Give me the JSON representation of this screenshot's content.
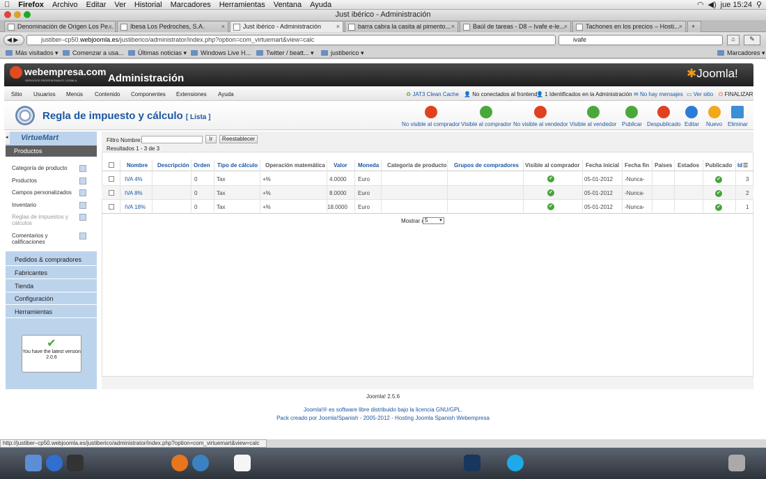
{
  "mac_menu": {
    "app": "Firefox",
    "items": [
      "Archivo",
      "Editar",
      "Ver",
      "Historial",
      "Marcadores",
      "Herramientas",
      "Ventana",
      "Ayuda"
    ],
    "clock": "jue 15:24"
  },
  "window_title": "Just ibérico - Administración",
  "tabs": [
    {
      "label": "Denominación de Origen Los Pe..."
    },
    {
      "label": "Ibesa Los Pedroches, S.A."
    },
    {
      "label": "Just ibérico - Administración"
    },
    {
      "label": "barra cabra la casita al pimento..."
    },
    {
      "label": "Baúl de tareas - D8 – Ivafe e-le..."
    },
    {
      "label": "Tachones en los precios – Hosti..."
    }
  ],
  "url": {
    "prefix": "justiber–cp50.",
    "domain": "webjoomla.es",
    "path": "/justiberico/administrator/index.php?option=com_virtuemart&view=calc"
  },
  "search_value": "ivafe",
  "bookmarks": [
    "Más visitados ▾",
    "Comenzar a usa...",
    "Últimas noticias ▾",
    "Windows Live H...",
    "Twitter / beatt... ▾",
    "justiberico ▾",
    "Marcadores ▾"
  ],
  "header": {
    "logo": "webempresa.com",
    "logo_sub": "SERVICIOS PROFESIONALES JOOMLA",
    "title": "Administración",
    "brand": "Joomla!"
  },
  "topmenu": [
    "Sitio",
    "Usuarios",
    "Menús",
    "Contenido",
    "Componentes",
    "Extensiones",
    "Ayuda"
  ],
  "status": {
    "cache": "JAT3 Clean Cache",
    "frontend": "No conectados al frontend",
    "admin": "1 Identificados en la Administración",
    "messages": "No hay mensajes",
    "view": "Ver sitio",
    "logout": "FINALIZAR"
  },
  "page": {
    "title": "Regla de impuesto y cálculo",
    "subtitle": "[ Lista ]"
  },
  "toolbar": [
    {
      "label": "No visible al comprador",
      "color": "#e0421f"
    },
    {
      "label": "Visible al comprador",
      "color": "#4aa83b"
    },
    {
      "label": "No visible al vendedor",
      "color": "#e0421f"
    },
    {
      "label": "Visible al vendedor",
      "color": "#4aa83b"
    },
    {
      "label": "Publicar",
      "color": "#4aa83b"
    },
    {
      "label": "Despublicado",
      "color": "#e0421f"
    },
    {
      "label": "Editar",
      "color": "#2b7cd6"
    },
    {
      "label": "Nuevo",
      "color": "#f2a81c"
    },
    {
      "label": "Eliminar",
      "color": "#3c8fd6"
    }
  ],
  "sidebar": {
    "logo": "VirtueMart",
    "head": "Productos",
    "items": [
      "Categoría de producto",
      "Productos",
      "Campos personalizados",
      "Inventario",
      "Reglas de impuestos y cálculos",
      "Comentarios y calificaciones"
    ],
    "groups": [
      "Pedidos & compradores",
      "Fabricantes",
      "Tienda",
      "Configuración",
      "Herramientas"
    ],
    "version_text": "You have the latest version",
    "version": "2.0.6"
  },
  "filter": {
    "label": "Filtro Nombre:",
    "go": "Ir",
    "reset": "Reestablecer",
    "results": "Resultados 1 - 3 de 3"
  },
  "table": {
    "headers": [
      "Nombre",
      "Descripción",
      "Orden",
      "Tipo de cálculo",
      "Operación matemática",
      "Valor",
      "Moneda",
      "Categoría de producto",
      "Grupos de compradores",
      "Visible al comprador",
      "Fecha inicial",
      "Fecha fin",
      "Países",
      "Estados",
      "Publicado",
      "Id"
    ],
    "rows": [
      {
        "name": "IVA 4%",
        "order": "0",
        "type": "Tax",
        "op": "+%",
        "value": "4.0000",
        "currency": "Euro",
        "start": "05-01-2012",
        "end": "-Nunca-",
        "id": "3"
      },
      {
        "name": "IVA 8%",
        "order": "0",
        "type": "Tax",
        "op": "+%",
        "value": "8.0000",
        "currency": "Euro",
        "start": "05-01-2012",
        "end": "-Nunca-",
        "id": "2"
      },
      {
        "name": "IVA 18%",
        "order": "0",
        "type": "Tax",
        "op": "+%",
        "value": "18.0000",
        "currency": "Euro",
        "start": "05-01-2012",
        "end": "-Nunca-",
        "id": "1"
      }
    ]
  },
  "pager": {
    "label": "Mostrar #",
    "value": "5"
  },
  "footer": {
    "version": "Joomla! 2.5.6",
    "license": "Joomla!® es software libre distribuido bajo la licencia GNU/GPL.",
    "pack": "Pack creado por Joomla!Spanish - 2005-2012 - Hosting Joomla Spanish Webempresa"
  },
  "statusbar": "http://justiber–cp50.webjoomla.es/justiberico/administrator/index.php?option=com_virtuemart&view=calc",
  "dock_icons": [
    "finder-icon",
    "app-store-icon",
    "dashboard-icon",
    "safari-icon",
    "firefox-icon",
    "calendar-icon",
    "photoshop-icon",
    "skype-icon",
    "trash-icon"
  ]
}
